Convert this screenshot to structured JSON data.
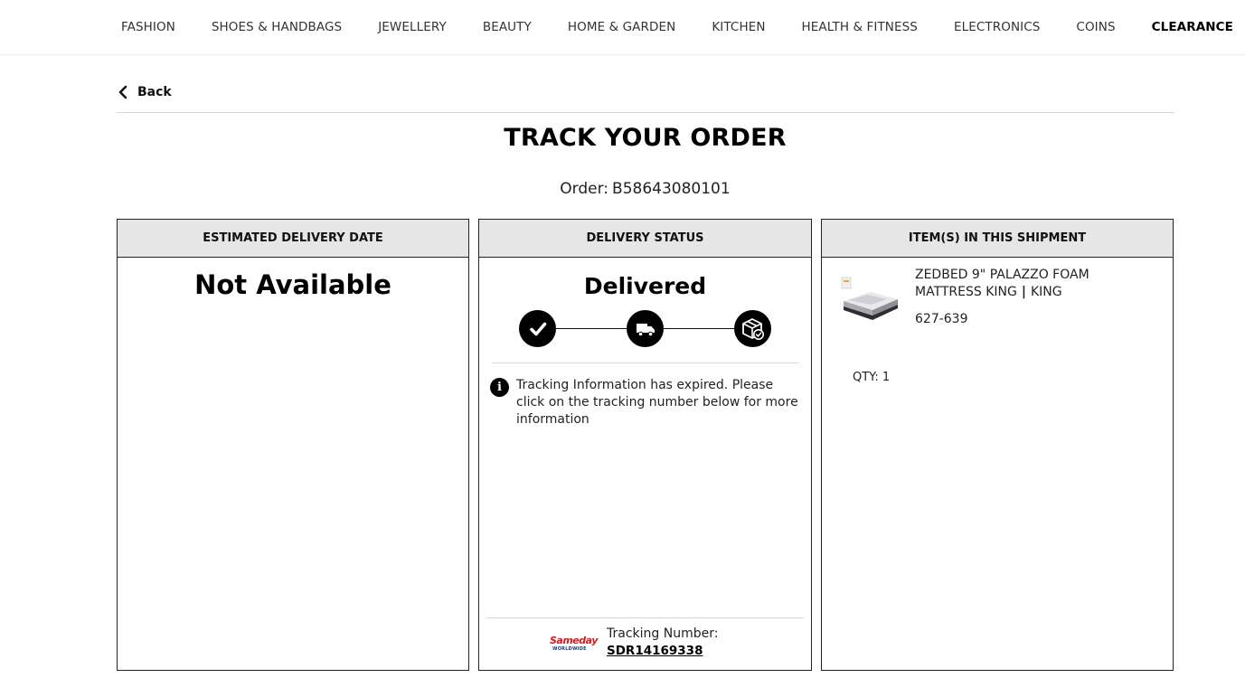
{
  "nav": {
    "items": [
      "FASHION",
      "SHOES & HANDBAGS",
      "JEWELLERY",
      "BEAUTY",
      "HOME & GARDEN",
      "KITCHEN",
      "HEALTH & FITNESS",
      "ELECTRONICS",
      "COINS",
      "CLEARANCE"
    ]
  },
  "back_label": "Back",
  "page_title": "TRACK YOUR ORDER",
  "order": {
    "label": "Order:",
    "number": "B58643080101"
  },
  "panels": {
    "delivery_date": {
      "header": "ESTIMATED DELIVERY DATE",
      "value": "Not Available"
    },
    "status": {
      "header": "DELIVERY STATUS",
      "value": "Delivered",
      "steps": [
        "check-icon",
        "truck-icon",
        "package-delivered-icon"
      ],
      "note": "Tracking Information has expired. Please click on the tracking number below for more information",
      "carrier_logo": {
        "line1": "Sameday",
        "line2": "WORLDWIDE"
      },
      "tracking_label": "Tracking Number:",
      "tracking_number": "SDR14169338"
    },
    "shipment": {
      "header": "ITEM(S) IN THIS SHIPMENT",
      "item_name": "ZEDBED 9\" PALAZZO FOAM MATTRESS KING",
      "item_separator": "|",
      "item_variant": "KING",
      "sku": "627-639",
      "qty_label": "QTY:",
      "qty": "1"
    }
  }
}
